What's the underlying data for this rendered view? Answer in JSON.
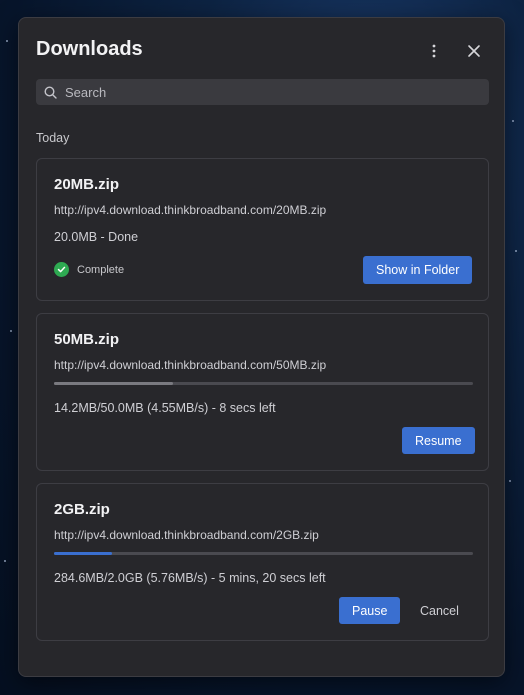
{
  "panel": {
    "title": "Downloads",
    "more_icon": "more-vertical-icon",
    "close_icon": "close-icon"
  },
  "search": {
    "placeholder": "Search",
    "value": "",
    "icon": "search-icon"
  },
  "section_label": "Today",
  "downloads": [
    {
      "filename": "20MB.zip",
      "url": "http://ipv4.download.thinkbroadband.com/20MB.zip",
      "status": "20.0MB - Done",
      "state_label": "Complete",
      "state_icon": "check-circle-icon",
      "state_color": "#2eaa52",
      "action": "Show in Folder"
    },
    {
      "filename": "50MB.zip",
      "url": "http://ipv4.download.thinkbroadband.com/50MB.zip",
      "progress": 0.284,
      "progress_color": "#7a7a80",
      "status": "14.2MB/50.0MB (4.55MB/s) - 8 secs left",
      "action": "Resume"
    },
    {
      "filename": "2GB.zip",
      "url": "http://ipv4.download.thinkbroadband.com/2GB.zip",
      "progress": 0.139,
      "progress_color": "#3a6fd0",
      "status": "284.6MB/2.0GB (5.76MB/s) - 5 mins, 20 secs left",
      "action": "Pause",
      "secondary_action": "Cancel"
    }
  ],
  "colors": {
    "accent": "#3a6fd0",
    "panel_bg": "#27272b",
    "success": "#2eaa52"
  }
}
